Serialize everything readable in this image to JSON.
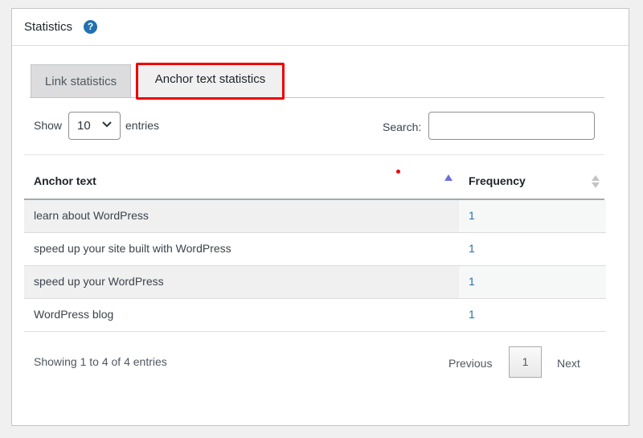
{
  "panel": {
    "title": "Statistics",
    "help_icon": "?"
  },
  "tabs": [
    {
      "label": "Link statistics",
      "active": false
    },
    {
      "label": "Anchor text statistics",
      "active": true
    }
  ],
  "controls": {
    "show_label": "Show",
    "page_size_value": "10",
    "entries_label": "entries",
    "search_label": "Search:",
    "search_value": ""
  },
  "table": {
    "columns": [
      "Anchor text",
      "Frequency"
    ],
    "sort_column": "Anchor text",
    "rows": [
      {
        "anchor": "learn about WordPress",
        "frequency": "1"
      },
      {
        "anchor": "speed up your site built with WordPress",
        "frequency": "1"
      },
      {
        "anchor": "speed up your WordPress",
        "frequency": "1"
      },
      {
        "anchor": "WordPress blog",
        "frequency": "1"
      }
    ]
  },
  "footer": {
    "info": "Showing 1 to 4 of 4 entries",
    "previous": "Previous",
    "current_page": "1",
    "next": "Next"
  },
  "colors": {
    "accent": "#2271b1",
    "highlight_border": "#ee0000",
    "sort_indicator": "#6f6fd8"
  }
}
